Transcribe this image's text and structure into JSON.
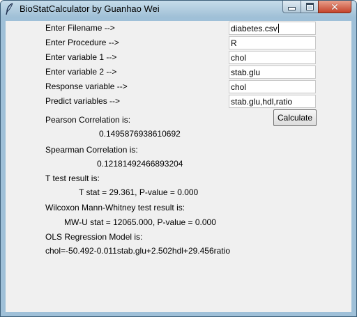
{
  "window": {
    "title": "BioStatCalculator by Guanhao Wei"
  },
  "form": {
    "filename_label": "Enter Filename -->",
    "filename_value": "diabetes.csv",
    "procedure_label": "Enter Procedure -->",
    "procedure_value": "R",
    "var1_label": "Enter variable 1 -->",
    "var1_value": "chol",
    "var2_label": "Enter variable 2 -->",
    "var2_value": "stab.glu",
    "response_label": "Response variable -->",
    "response_value": "chol",
    "predict_label": "Predict variables -->",
    "predict_value": "stab.glu,hdl,ratio",
    "calculate_label": "Calculate"
  },
  "results": {
    "pearson_label": "Pearson Correlation is:",
    "pearson_value": "0.1495876938610692",
    "spearman_label": "Spearman Correlation is:",
    "spearman_value": "0.12181492466893204",
    "ttest_label": "T test result is:",
    "ttest_value": "T stat = 29.361, P-value = 0.000",
    "wilcoxon_label": "Wilcoxon Mann-Whitney test result is:",
    "wilcoxon_value": "MW-U stat = 12065.000, P-value = 0.000",
    "ols_label": "OLS Regression Model is:",
    "ols_value": "chol=-50.492-0.011stab.glu+2.502hdl+29.456ratio"
  },
  "icons": {
    "app": "feather-icon",
    "minimize": "minimize-icon",
    "maximize": "maximize-icon",
    "close": "close-icon"
  },
  "colors": {
    "titlebar": "#9fc0d8",
    "client_background": "#f0f0f0",
    "close_button": "#c5432a"
  }
}
